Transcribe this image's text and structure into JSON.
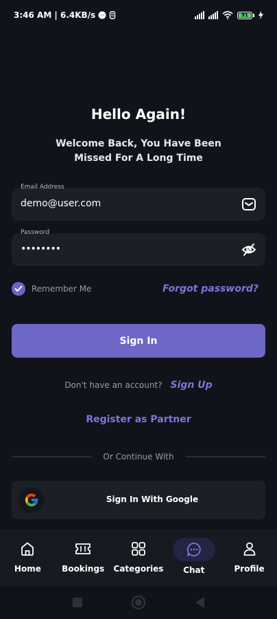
{
  "status_bar": {
    "time_network": "3:46 AM | 6.4KB/s",
    "battery_level": "91"
  },
  "header": {
    "title": "Hello Again!",
    "subtitle": "Welcome Back, You Have Been Missed For A Long Time"
  },
  "form": {
    "email": {
      "label": "Email Address",
      "value": "demo@user.com",
      "icon": "mail-icon"
    },
    "password": {
      "label": "Password",
      "value": "••••••••",
      "icon": "eye-off-icon"
    },
    "remember_label": "Remember Me",
    "remember_checked": true,
    "forgot_label": "Forgot password?",
    "signin_label": "Sign In"
  },
  "signup": {
    "prompt": "Don't have an account?",
    "link": "Sign Up"
  },
  "partner_label": "Register as Partner",
  "divider_text": "Or Continue With",
  "google_button": {
    "label": "Sign In With Google"
  },
  "nav": {
    "items": [
      {
        "label": "Home",
        "icon": "home-icon"
      },
      {
        "label": "Bookings",
        "icon": "ticket-icon"
      },
      {
        "label": "Categories",
        "icon": "grid-icon"
      },
      {
        "label": "Chat",
        "icon": "chat-icon",
        "active": true
      },
      {
        "label": "Profile",
        "icon": "user-icon"
      }
    ]
  },
  "colors": {
    "background": "#11131a",
    "surface": "#1d1f27",
    "accent": "#6d67c6",
    "link": "#7b76dc"
  }
}
